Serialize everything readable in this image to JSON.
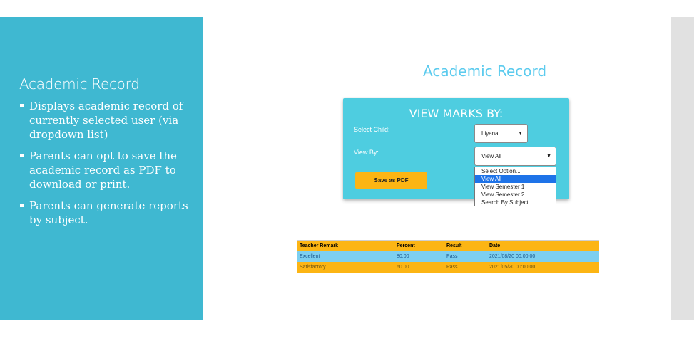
{
  "slide": {
    "title": "Academic Record",
    "bullets": [
      "Displays academic record of currently selected user (via dropdown list)",
      "Parents can opt to save the academic record as PDF to download or print.",
      "Parents can generate reports by subject."
    ]
  },
  "app": {
    "title": "Academic Record",
    "card": {
      "heading": "VIEW MARKS BY:",
      "child_label": "Select Child:",
      "child_value": "Liyana",
      "view_label": "View By:",
      "view_value": "View All",
      "save_pdf_label": "Save as PDF"
    },
    "dropdown": {
      "options": [
        "Select Option...",
        "View All",
        "View Semester 1",
        "View Semester 2",
        "Search By Subject"
      ],
      "selected": "View All"
    },
    "table": {
      "headers": [
        "Teacher Remark",
        "Percent",
        "Result",
        "Date"
      ],
      "rows": [
        [
          "Excellent",
          "80.00",
          "Pass",
          "2021/08/20 00:00:00"
        ],
        [
          "Satisfactory",
          "60.00",
          "Pass",
          "2021/05/20 00:00:00"
        ]
      ]
    }
  },
  "colors": {
    "panel": "#3fb8d1",
    "card": "#4ecde0",
    "accent": "#fcb514",
    "title": "#5ccbee",
    "row_blue": "#7dcff0",
    "highlight": "#1e73e8"
  }
}
